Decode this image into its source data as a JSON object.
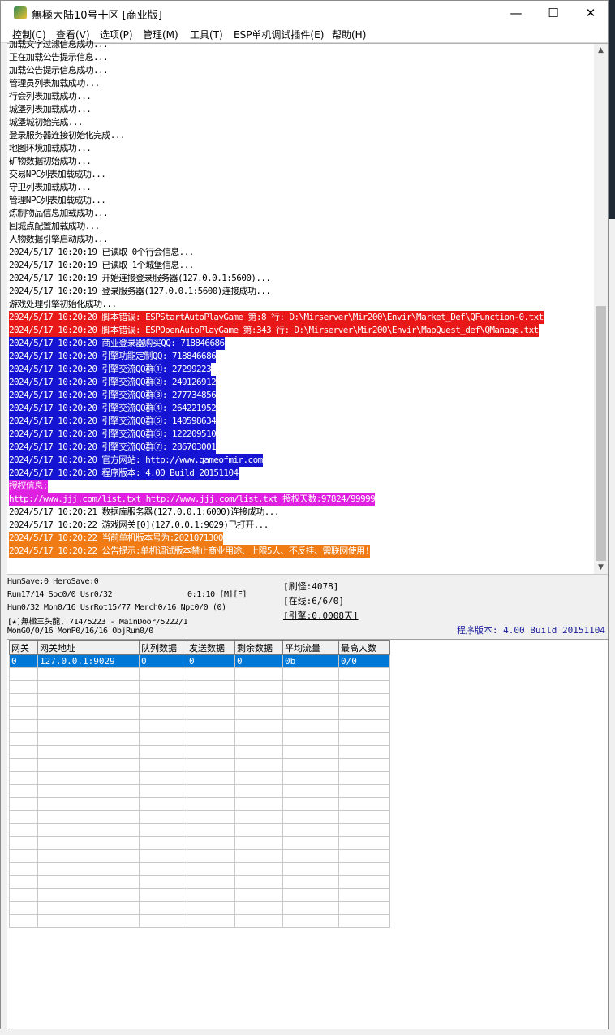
{
  "window": {
    "title": "無極大陆10号十区 [商业版]",
    "controls": [
      "—",
      "☐",
      "✕"
    ]
  },
  "menu": [
    "控制(C)",
    "查看(V)",
    "选项(P)",
    "管理(M)",
    "工具(T)",
    "ESP单机调试插件(E)",
    "帮助(H)"
  ],
  "log": [
    {
      "text": "加载文字过滤信息成功...",
      "bg": "",
      "fg": "#000000"
    },
    {
      "text": "正在加载公告提示信息...",
      "bg": "",
      "fg": "#000000"
    },
    {
      "text": "加载公告提示信息成功...",
      "bg": "",
      "fg": "#000000"
    },
    {
      "text": "管理员列表加载成功...",
      "bg": "",
      "fg": "#000000"
    },
    {
      "text": "行会列表加载成功...",
      "bg": "",
      "fg": "#000000"
    },
    {
      "text": "城堡列表加载成功...",
      "bg": "",
      "fg": "#000000"
    },
    {
      "text": "城堡城初始完成...",
      "bg": "",
      "fg": "#000000"
    },
    {
      "text": "登录服务器连接初始化完成...",
      "bg": "",
      "fg": "#000000"
    },
    {
      "text": "地图环境加载成功...",
      "bg": "",
      "fg": "#000000"
    },
    {
      "text": "矿物数据初始成功...",
      "bg": "",
      "fg": "#000000"
    },
    {
      "text": "交易NPC列表加载成功...",
      "bg": "",
      "fg": "#000000"
    },
    {
      "text": "守卫列表加载成功...",
      "bg": "",
      "fg": "#000000"
    },
    {
      "text": "管理NPC列表加载成功...",
      "bg": "",
      "fg": "#000000"
    },
    {
      "text": "炼制物品信息加载成功...",
      "bg": "",
      "fg": "#000000"
    },
    {
      "text": "回城点配置加载成功...",
      "bg": "",
      "fg": "#000000"
    },
    {
      "text": "人物数据引擎启动成功...",
      "bg": "",
      "fg": "#000000"
    },
    {
      "text": "2024/5/17 10:20:19 已读取 0个行会信息...",
      "bg": "",
      "fg": "#000000"
    },
    {
      "text": "2024/5/17 10:20:19 已读取 1个城堡信息...",
      "bg": "",
      "fg": "#000000"
    },
    {
      "text": "2024/5/17 10:20:19 开始连接登录服务器(127.0.0.1:5600)...",
      "bg": "",
      "fg": "#000000"
    },
    {
      "text": "2024/5/17 10:20:19 登录服务器(127.0.0.1:5600)连接成功...",
      "bg": "",
      "fg": "#000000"
    },
    {
      "text": "游戏处理引擎初始化成功...",
      "bg": "",
      "fg": "#000000"
    },
    {
      "text": "2024/5/17 10:20:20 脚本错误: ESPStartAutoPlayGame 第:8 行: D:\\Mirserver\\Mir200\\Envir\\Market_Def\\QFunction-0.txt",
      "bg": "#e81818",
      "fg": "#ffffff"
    },
    {
      "text": "2024/5/17 10:20:20 脚本错误: ESPOpenAutoPlayGame 第:343 行: D:\\Mirserver\\Mir200\\Envir\\MapQuest_def\\QManage.txt",
      "bg": "#e81818",
      "fg": "#ffffff"
    },
    {
      "text": "2024/5/17 10:20:20 商业登录器购买QQ: 718846686",
      "bg": "#1414d2",
      "fg": "#ffffff"
    },
    {
      "text": "2024/5/17 10:20:20 引擎功能定制QQ: 718846686",
      "bg": "#1414d2",
      "fg": "#ffffff"
    },
    {
      "text": "2024/5/17 10:20:20 引擎交流QQ群①: 27299223",
      "bg": "#1414d2",
      "fg": "#ffffff"
    },
    {
      "text": "2024/5/17 10:20:20 引擎交流QQ群②: 249126912",
      "bg": "#1414d2",
      "fg": "#ffffff"
    },
    {
      "text": "2024/5/17 10:20:20 引擎交流QQ群③: 277734856",
      "bg": "#1414d2",
      "fg": "#ffffff"
    },
    {
      "text": "2024/5/17 10:20:20 引擎交流QQ群④: 264221952",
      "bg": "#1414d2",
      "fg": "#ffffff"
    },
    {
      "text": "2024/5/17 10:20:20 引擎交流QQ群⑤: 140598634",
      "bg": "#1414d2",
      "fg": "#ffffff"
    },
    {
      "text": "2024/5/17 10:20:20 引擎交流QQ群⑥: 122209510",
      "bg": "#1414d2",
      "fg": "#ffffff"
    },
    {
      "text": "2024/5/17 10:20:20 引擎交流QQ群⑦: 286703001",
      "bg": "#1414d2",
      "fg": "#ffffff"
    },
    {
      "text": "2024/5/17 10:20:20 官方网站: http://www.gameofmir.com",
      "bg": "#1414d2",
      "fg": "#ffffff"
    },
    {
      "text": "2024/5/17 10:20:20 程序版本: 4.00 Build 20151104",
      "bg": "#1414d2",
      "fg": "#ffffff"
    },
    {
      "text": "授权信息:",
      "bg": "#e020e0",
      "fg": "#ffffff"
    },
    {
      "text": "http://www.jjj.com/list.txt http://www.jjj.com/list.txt 授权天数:97824/99999",
      "bg": "#e020e0",
      "fg": "#ffffff"
    },
    {
      "text": "2024/5/17 10:20:21 数据库服务器(127.0.0.1:6000)连接成功...",
      "bg": "",
      "fg": "#000000"
    },
    {
      "text": "2024/5/17 10:20:22 游戏网关[0](127.0.0.1:9029)已打开...",
      "bg": "",
      "fg": "#000000"
    },
    {
      "text": "2024/5/17 10:20:22 当前单机版本号为:2021071300",
      "bg": "#f07a14",
      "fg": "#ffffff"
    },
    {
      "text": "2024/5/17 10:20:22 公告提示:单机调试版本禁止商业用途、上限5人、不反挂、需联网使用!",
      "bg": "#f07a14",
      "fg": "#ffffff"
    }
  ],
  "status": {
    "line1": "HumSave:0 HeroSave:0",
    "line2a": "Run17/14 Soc0/0 Usr0/32",
    "line2b": "0:1:10 [M][F]",
    "line3": "Hum0/32 Mon0/16 UsrRot15/77 Merch0/16 Npc0/0 (0)",
    "line4": "[★]無極三头龍, 714/5223 - MainDoor/5222/1",
    "line5": "MonG0/0/16 MonP0/16/16 ObjRun0/0",
    "refresh": "[刷怪:4078]",
    "online": "[在线:6/6/0]",
    "engine": "[引擎:0.0008天]",
    "version": "程序版本: 4.00 Build 20151104"
  },
  "grid": {
    "columns": [
      "网关",
      "网关地址",
      "队列数据",
      "发送数据",
      "剩余数据",
      "平均流量",
      "最高人数"
    ],
    "rows": [
      [
        "0",
        "127.0.0.1:9029",
        "0",
        "0",
        "0",
        "0b",
        "0/0"
      ]
    ]
  }
}
